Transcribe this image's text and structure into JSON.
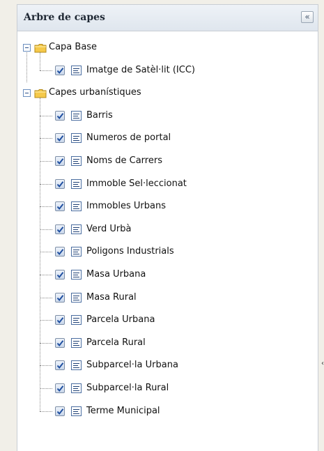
{
  "panel": {
    "title": "Arbre de capes",
    "collapse_icon": "double-chevron-left-icon",
    "collapse_glyph": "«"
  },
  "tree": {
    "groups": [
      {
        "label": "Capa Base",
        "expanded": true,
        "layers": [
          {
            "label": "Imatge de Satèl·lit (ICC)",
            "checked": true
          }
        ]
      },
      {
        "label": "Capes urbanístiques",
        "expanded": true,
        "layers": [
          {
            "label": "Barris",
            "checked": true
          },
          {
            "label": "Numeros de portal",
            "checked": true
          },
          {
            "label": "Noms de Carrers",
            "checked": true
          },
          {
            "label": "Immoble Sel·leccionat",
            "checked": true
          },
          {
            "label": "Immobles Urbans",
            "checked": true
          },
          {
            "label": "Verd Urbà",
            "checked": true
          },
          {
            "label": "Poligons Industrials",
            "checked": true
          },
          {
            "label": "Masa Urbana",
            "checked": true
          },
          {
            "label": "Masa Rural",
            "checked": true
          },
          {
            "label": "Parcela Urbana",
            "checked": true
          },
          {
            "label": "Parcela Rural",
            "checked": true
          },
          {
            "label": "Subparcel·la Urbana",
            "checked": true
          },
          {
            "label": "Subparcel·la Rural",
            "checked": true
          },
          {
            "label": "Terme Municipal",
            "checked": true
          }
        ]
      }
    ]
  },
  "colors": {
    "folder": "#f5c94a",
    "check": "#1f4fa0",
    "layer_icon": "#1d3f74"
  }
}
